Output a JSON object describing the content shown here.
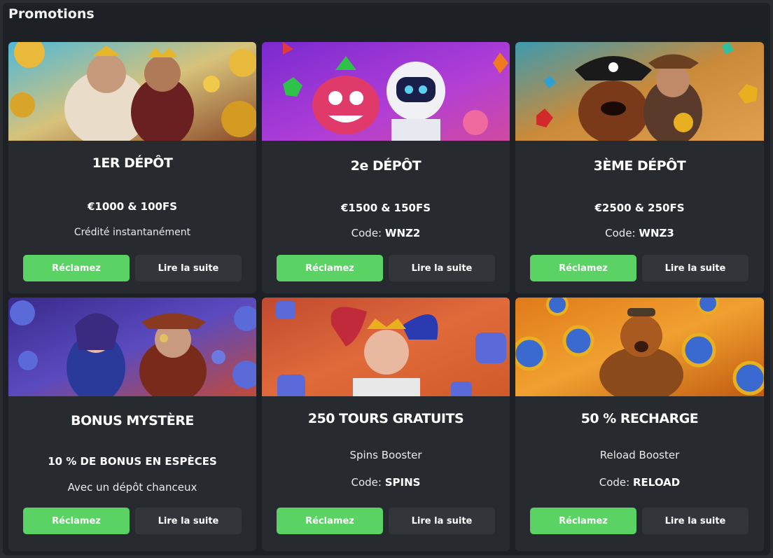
{
  "page": {
    "title": "Promotions"
  },
  "colors": {
    "claim": "#5bd264",
    "more": "#32363b",
    "card": "#272a2f",
    "panel": "#1d2024"
  },
  "promotions": [
    {
      "title": "1ER DÉPÔT",
      "subtitle": "€1000 & 100FS",
      "desc": "Crédité instantanément",
      "code_label": "",
      "code": "",
      "claim": "Réclamez",
      "more": "Lire la suite",
      "banner": "zeus-kings-gold-coins"
    },
    {
      "title": "2e DÉPÔT",
      "subtitle": "€1500 & 150FS",
      "desc": "",
      "code_label": "Code:",
      "code": "WNZ2",
      "claim": "Réclamez",
      "more": "Lire la suite",
      "banner": "fruit-monster-astronaut"
    },
    {
      "title": "3ÈME DÉPÔT",
      "subtitle": "€2500 & 250FS",
      "desc": "",
      "code_label": "Code:",
      "code": "WNZ3",
      "claim": "Réclamez",
      "more": "Lire la suite",
      "banner": "pirate-dog-adventurer-gems"
    },
    {
      "title": "BONUS MYSTÈRE",
      "subtitle": "10 % DE BONUS EN ESPÈCES",
      "desc": "Avec un dépôt chanceux",
      "code_label": "",
      "code": "",
      "claim": "Réclamez",
      "more": "Lire la suite",
      "banner": "mystery-question-marks"
    },
    {
      "title": "250 TOURS GRATUITS",
      "subtitle": "",
      "desc": "Spins Booster",
      "code_label": "Code:",
      "code": "SPINS",
      "claim": "Réclamez",
      "more": "Lire la suite",
      "banner": "jester-spin-icons"
    },
    {
      "title": "50 % RECHARGE",
      "subtitle": "",
      "desc": "Reload Booster",
      "code_label": "Code:",
      "code": "RELOAD",
      "claim": "Réclamez",
      "more": "Lire la suite",
      "banner": "lightning-hero-coins"
    }
  ]
}
